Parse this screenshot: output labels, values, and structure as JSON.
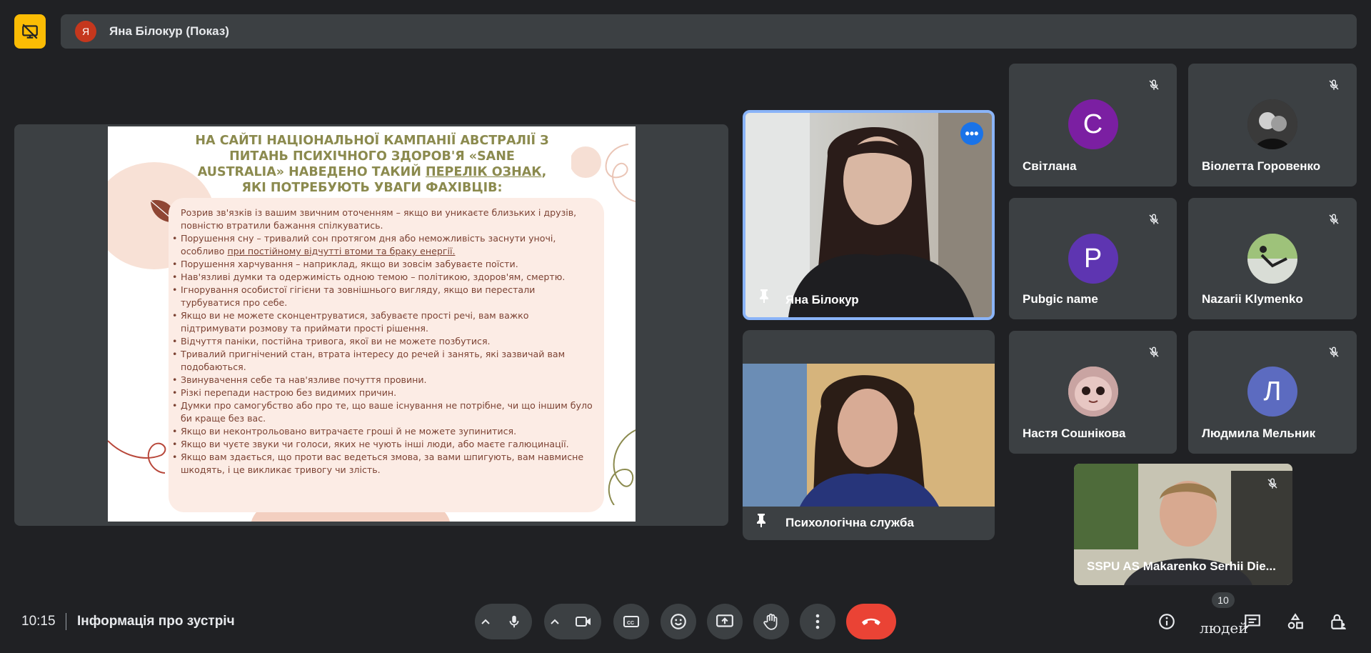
{
  "top": {
    "presenter_initial": "Я",
    "presenter_title": "Яна Білокур (Показ)"
  },
  "slide": {
    "title_part1": "НА САЙТІ НАЦІОНАЛЬНОЇ КАМПАНІЇ АВСТРАЛІЇ З ПИТАНЬ ПСИХІЧНОГО ЗДОРОВ'Я «SANE AUSTRALIA» НАВЕДЕНО ТАКИЙ",
    "title_link": "ПЕРЕЛІК ОЗНАК",
    "title_part2": ", ЯКІ ПОТРЕБУЮТЬ УВАГИ ФАХІВЦІВ:",
    "items": [
      "Розрив зв'язків із вашим звичним оточенням – якщо ви уникаєте близьких і друзів, повністю втратили бажання спілкуватись.",
      "Порушення сну – тривалий сон протягом дня або неможливість заснути уночі, особливо",
      "Порушення харчування – наприклад, якщо ви зовсім забуваєте поїсти.",
      "Нав'язливі думки та одержимість одною темою – політикою, здоров'ям, смертю.",
      "Ігнорування особистої гігієни та зовнішнього вигляду, якщо ви перестали турбуватися про себе.",
      "Якщо ви не можете сконцентруватися, забуваєте прості речі, вам важко підтримувати розмову та приймати прості рішення.",
      "Відчуття паніки, постійна тривога, якої ви не можете позбутися.",
      "Тривалий пригнічений стан, втрата інтересу до речей і занять, які зазвичай вам подобаються.",
      "Звинувачення себе та нав'язливе почуття провини.",
      "Різкі перепади настрою без видимих причин.",
      "Думки про самогубство або про те, що ваше існування не потрібне, чи що іншим було би краще без вас.",
      "Якщо ви неконтрольовано витрачаєте гроші й не можете зупинитися.",
      "Якщо ви чуєте звуки чи голоси, яких не чують інші люди, або маєте галюцинації.",
      "Якщо вам здається, що проти вас ведеться змова, за вами шпигують, вам навмисне шкодять, і це викликає тривогу чи злість."
    ],
    "item2_underlined": "при постійному відчутті втоми та браку енергії."
  },
  "tiles": {
    "main_video_name": "Яна Білокур",
    "psy_video_name": "Психологічна служба",
    "participants": [
      {
        "name": "Світлана",
        "initial": "C",
        "color": "#7b1fa2"
      },
      {
        "name": "Віолетта Горовенко",
        "initial": "",
        "color": "#2b2b2b"
      },
      {
        "name": "Pubgic name",
        "initial": "P",
        "color": "#5e35b1"
      },
      {
        "name": "Nazarii Klymenko",
        "initial": "",
        "color": "#7d8a7a"
      },
      {
        "name": "Настя Сошнікова",
        "initial": "",
        "color": "#caa7a6"
      },
      {
        "name": "Людмила Мельник",
        "initial": "Л",
        "color": "#5c6bc0"
      }
    ],
    "bottom_video_name": "SSPU AS Makarenko Serhii Die..."
  },
  "bottom": {
    "time": "10:15",
    "meeting_info": "Інформація про зустріч",
    "people_count": "10",
    "people_label": "людей"
  },
  "colors": {
    "background": "#202124",
    "tile": "#3c4043",
    "accent_blue": "#8ab4f8",
    "end_call": "#ea4335",
    "top_icon": "#fbbc04"
  }
}
